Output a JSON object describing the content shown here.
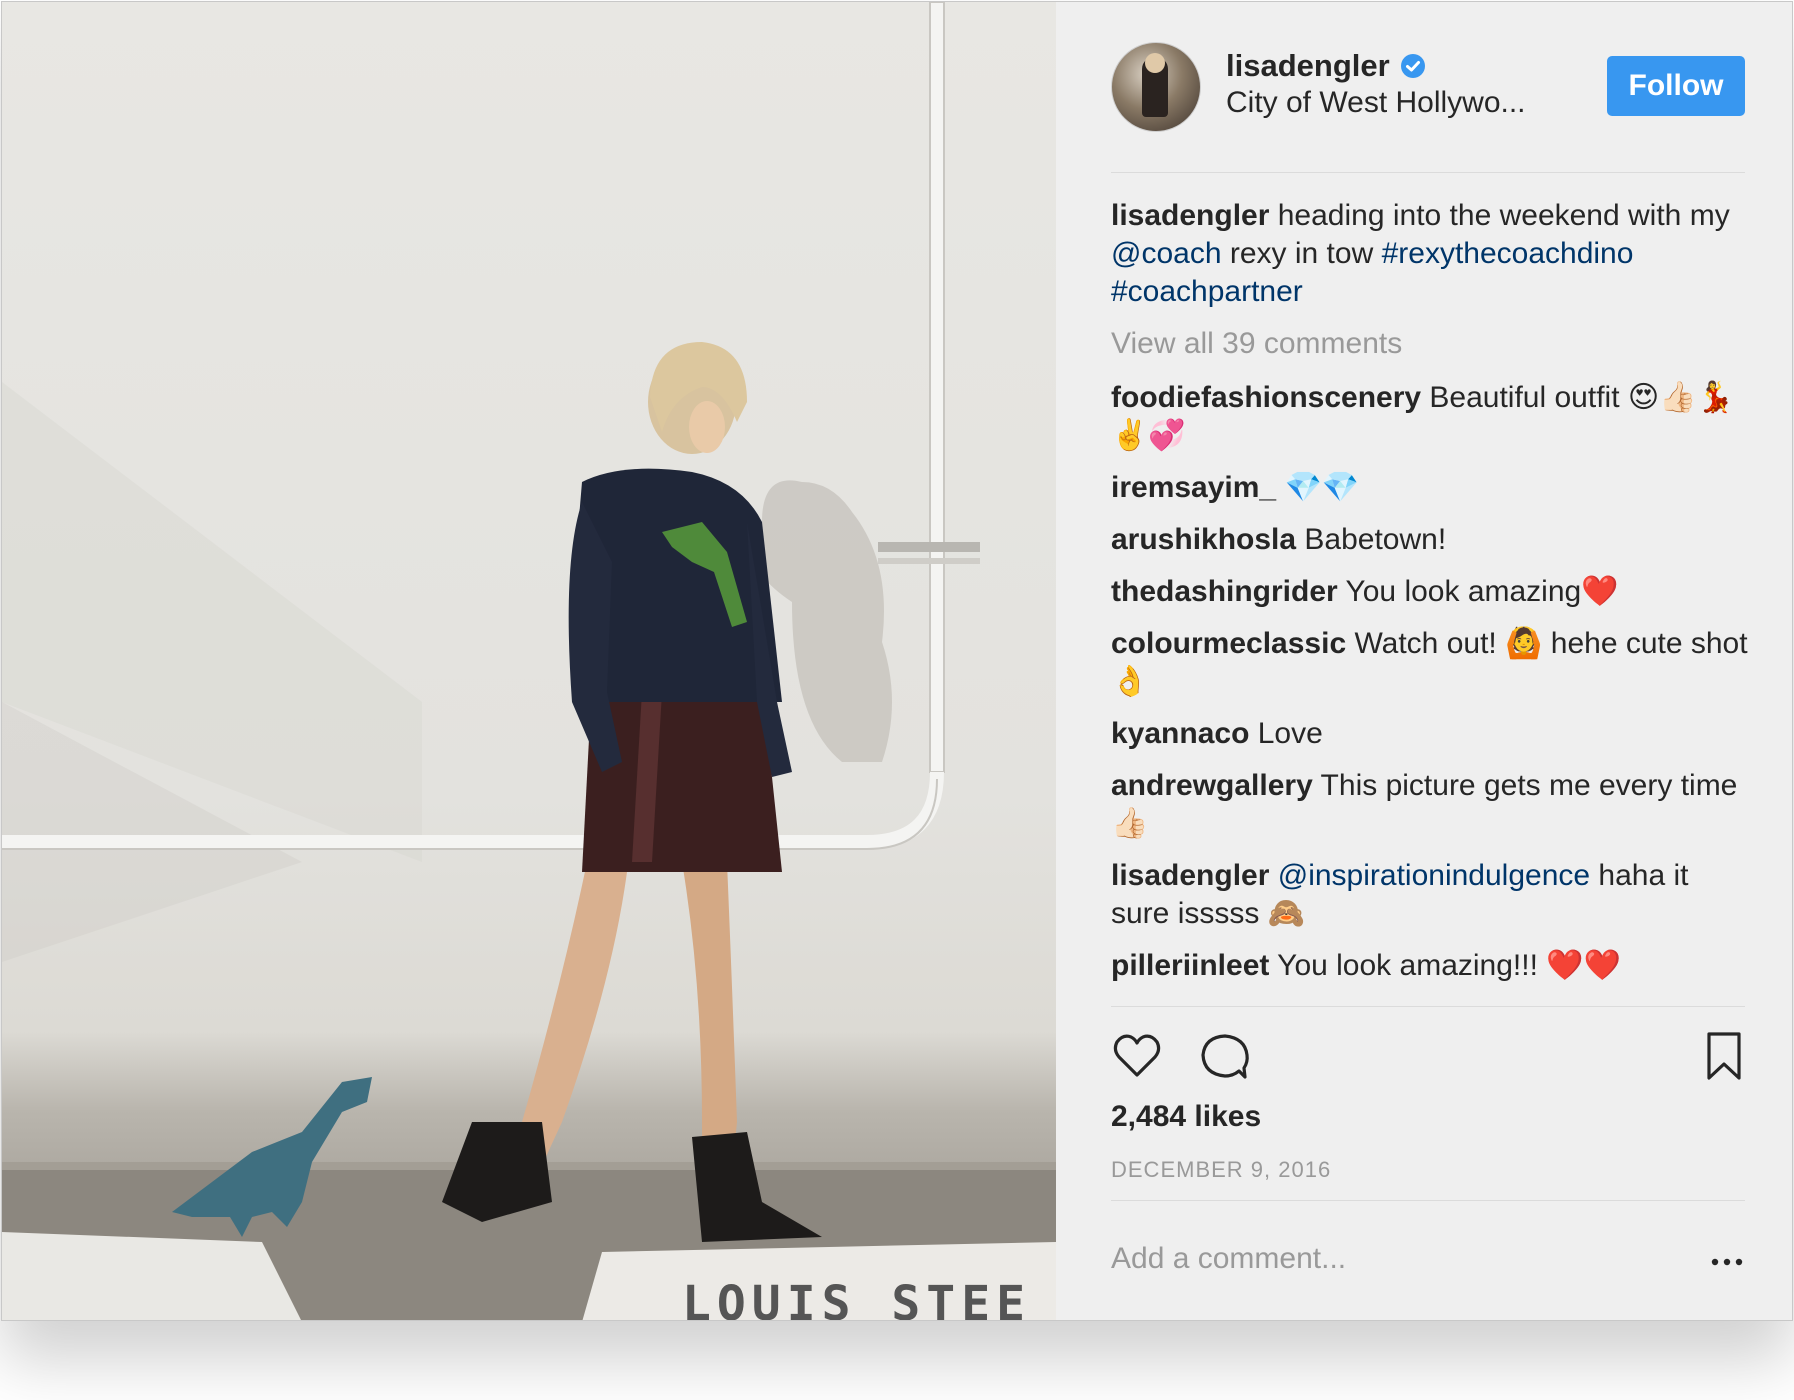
{
  "post": {
    "username": "lisadengler",
    "location": "City of West Hollywo...",
    "follow_label": "Follow",
    "likes": "2,484 likes",
    "date": "DECEMBER 9, 2016",
    "add_comment_placeholder": "Add a comment...",
    "view_all": "View all 39 comments"
  },
  "caption": {
    "user": "lisadengler",
    "t1": " heading into the weekend with my ",
    "mention": "@coach",
    "t2": " rexy in tow ",
    "tag1": "#rexythecoachdino",
    "t3": " ",
    "tag2": "#coachpartner"
  },
  "comments": [
    {
      "user": "foodiefashionscenery",
      "text": " Beautiful outfit 😍👍🏻💃✌️💞"
    },
    {
      "user": "iremsayim_",
      "text": " 💎💎"
    },
    {
      "user": "arushikhosla",
      "text": " Babetown!"
    },
    {
      "user": "thedashingrider",
      "text": " You look amazing❤️"
    },
    {
      "user": "colourmeclassic",
      "text": " Watch out! 🙆 hehe cute shot 👌"
    },
    {
      "user": "kyannaco",
      "text": " Love"
    },
    {
      "user": "andrewgallery",
      "text": " This picture gets me every time 👍🏻"
    },
    {
      "user": "lisadengler",
      "mention": "@inspirationindulgence",
      "text": " haha it sure isssss 🙈"
    },
    {
      "user": "pilleriinleet",
      "text": " You look amazing!!! ❤️❤️"
    }
  ],
  "photo": {
    "sign_text": "LOUIS STEE"
  },
  "colors": {
    "follow": "#3897f0",
    "link": "#003569",
    "muted": "#999999",
    "panel": "#efefef"
  },
  "icons": [
    "verified-badge-icon",
    "heart-icon",
    "comment-icon",
    "bookmark-icon",
    "more-options-icon"
  ]
}
